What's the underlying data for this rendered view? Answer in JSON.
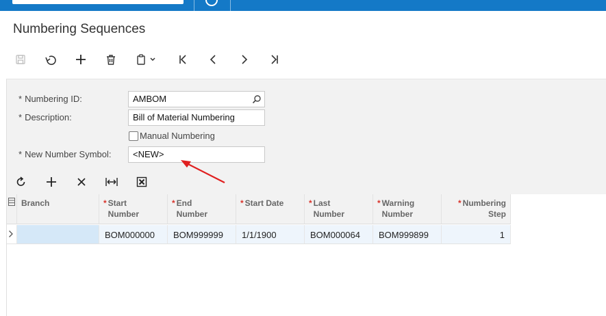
{
  "colors": {
    "topbar": "#1479c7",
    "required_star": "#d9342b",
    "annotation_arrow": "#e02020"
  },
  "page": {
    "title": "Numbering Sequences"
  },
  "toolbar": {
    "icons": [
      "save-icon",
      "undo-icon",
      "add-icon",
      "delete-icon",
      "copy-paste-icon",
      "first-record-icon",
      "previous-record-icon",
      "next-record-icon",
      "last-record-icon"
    ]
  },
  "form": {
    "numbering_id": {
      "label": "Numbering ID:",
      "required": "*",
      "value": "AMBOM"
    },
    "description": {
      "label": "Description:",
      "required": "*",
      "value": "Bill of Material Numbering"
    },
    "manual_numbering": {
      "label": "Manual Numbering",
      "checked": false
    },
    "new_number_symbol": {
      "label": "New Number Symbol:",
      "required": "*",
      "value": "<NEW>"
    }
  },
  "grid_toolbar": {
    "icons": [
      "refresh-icon",
      "add-row-icon",
      "delete-row-icon",
      "fit-columns-icon",
      "export-excel-icon"
    ]
  },
  "grid": {
    "columns": [
      {
        "key": "branch",
        "line1": "Branch",
        "line2": "",
        "required": false
      },
      {
        "key": "start_number",
        "line1": "Start",
        "line2": "Number",
        "required": true
      },
      {
        "key": "end_number",
        "line1": "End",
        "line2": "Number",
        "required": true
      },
      {
        "key": "start_date",
        "line1": "Start Date",
        "line2": "",
        "required": true
      },
      {
        "key": "last_number",
        "line1": "Last",
        "line2": "Number",
        "required": true
      },
      {
        "key": "warning_number",
        "line1": "Warning",
        "line2": "Number",
        "required": true
      },
      {
        "key": "numbering_step",
        "line1": "Numbering",
        "line2": "Step",
        "required": true
      }
    ],
    "rows": [
      {
        "branch": "",
        "start_number": "BOM000000",
        "end_number": "BOM999999",
        "start_date": "1/1/1900",
        "last_number": "BOM000064",
        "warning_number": "BOM999899",
        "numbering_step": "1"
      }
    ]
  }
}
